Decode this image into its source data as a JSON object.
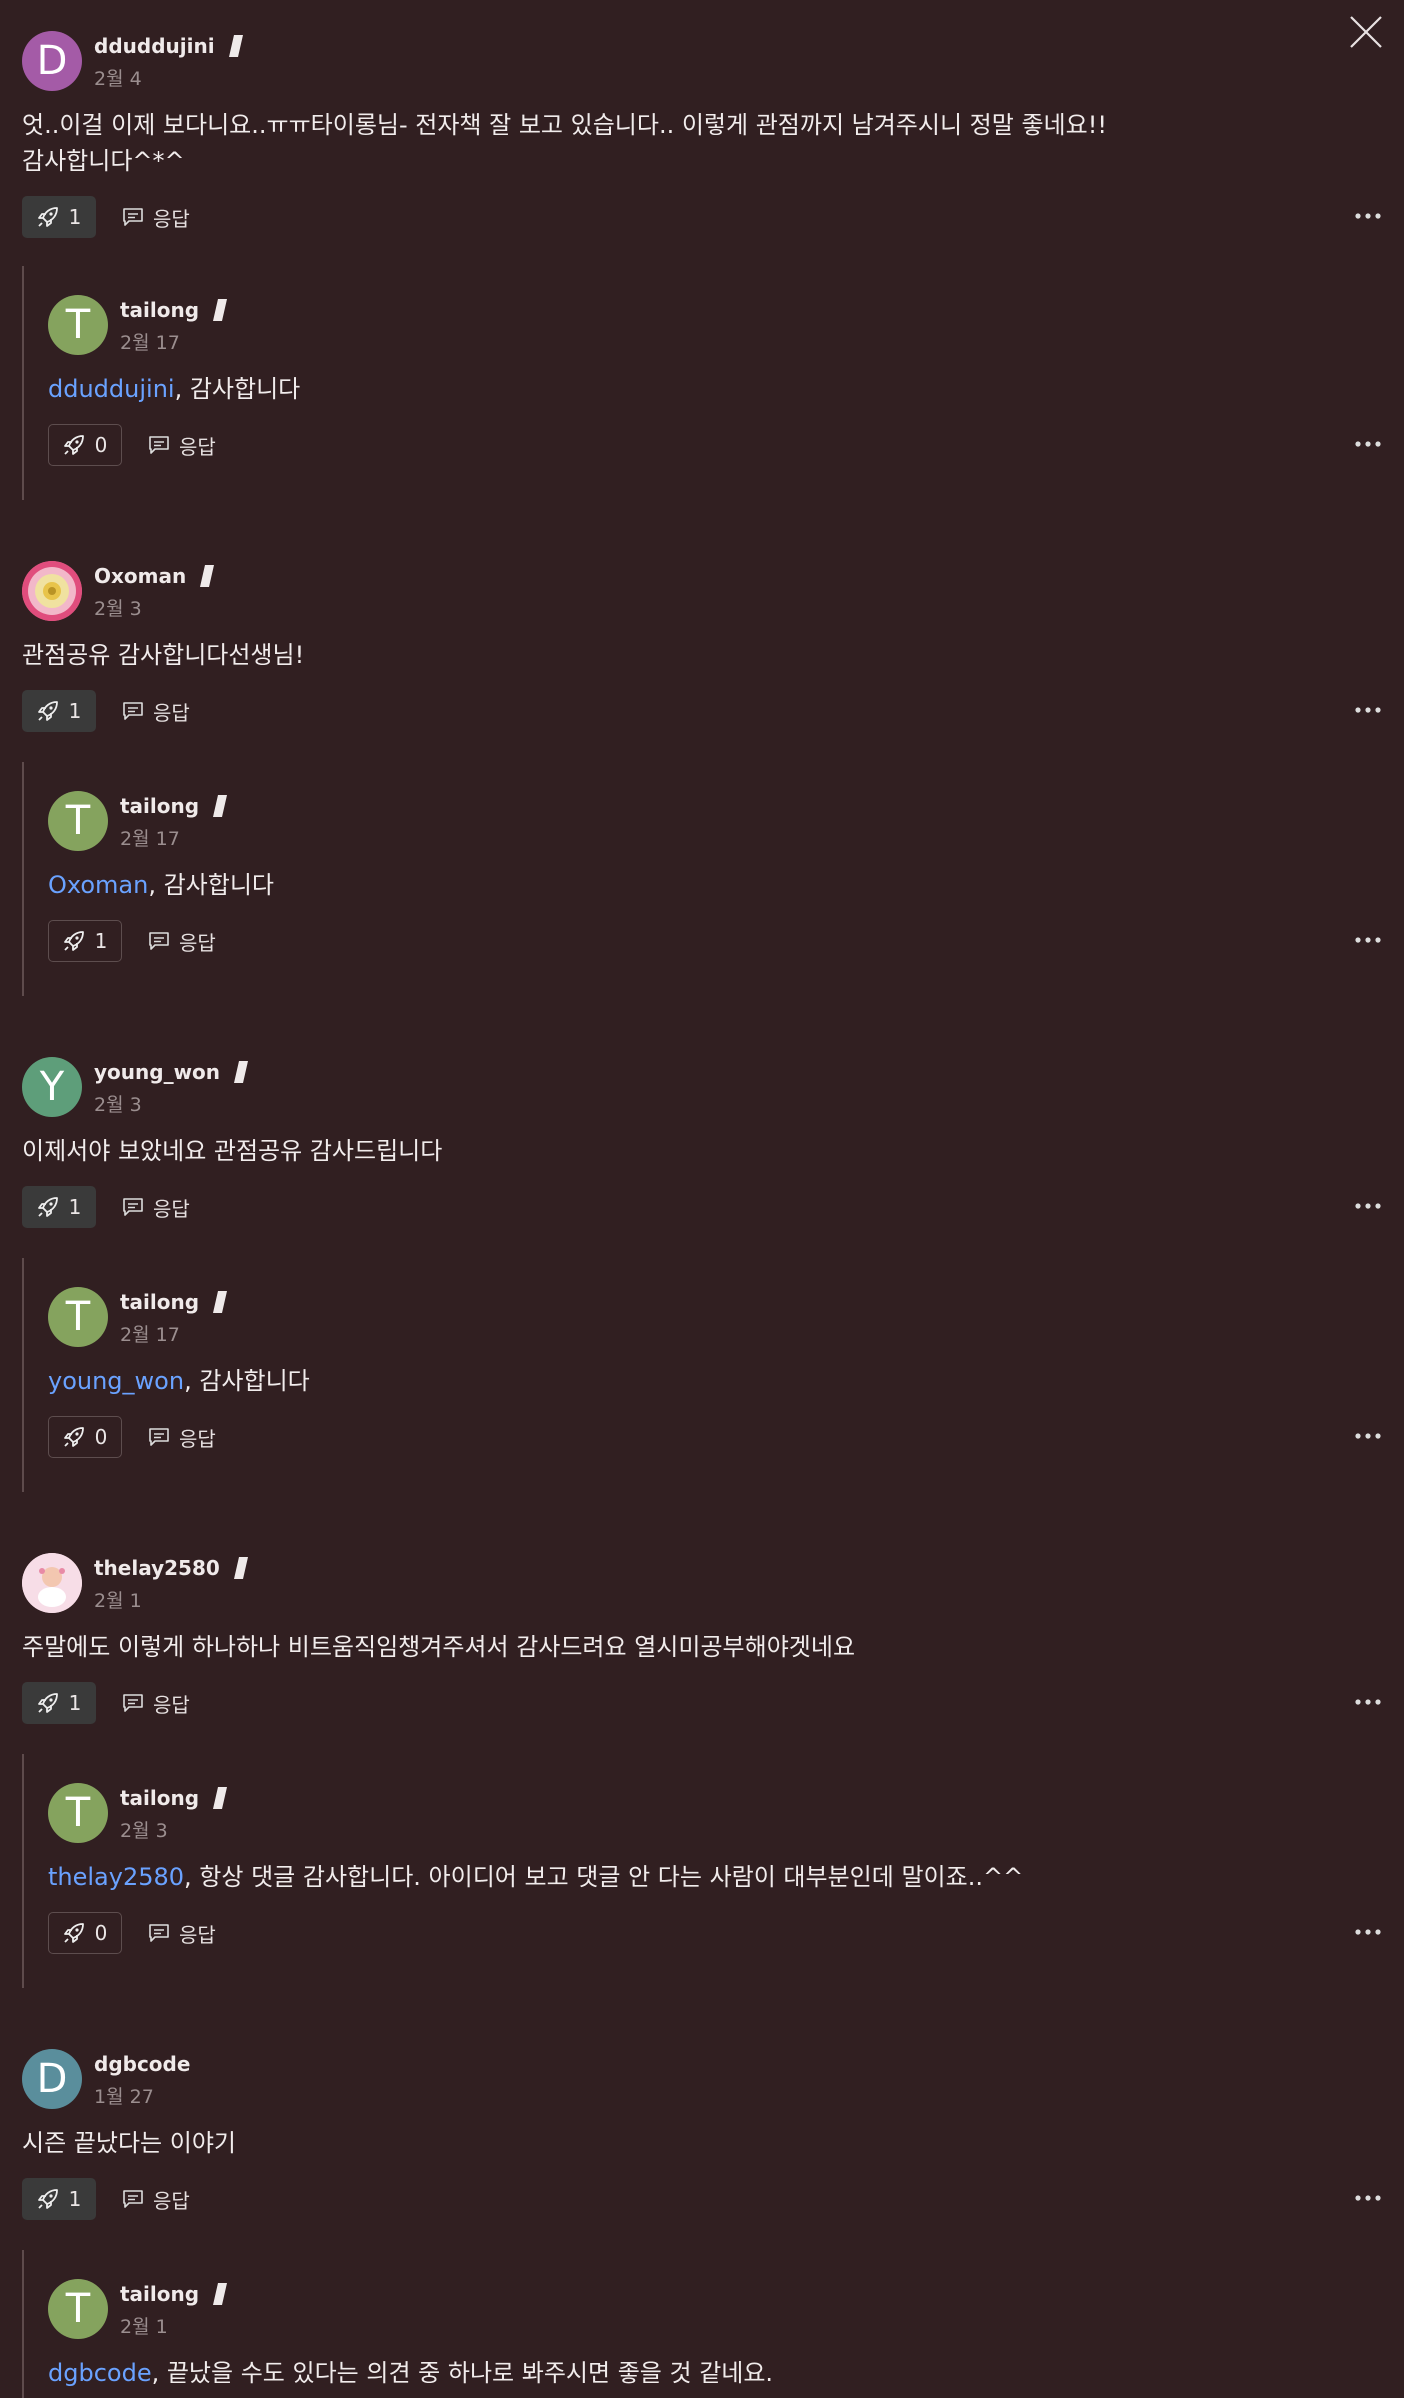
{
  "close_label": "",
  "reply_label": "응답",
  "comments": [
    {
      "user": "dduddujini",
      "date": "2월 4",
      "avatar_letter": "D",
      "avatar_color": "#a45ba7",
      "text": "엇..이걸 이제 보다니요..ㅠㅠ타이롱님- 전자책 잘 보고 있습니다.. 이렇게 관점까지 남겨주시니 정말 좋네요!!\n감사합니다^*^",
      "likes": "1",
      "reply": {
        "user": "tailong",
        "date": "2월 17",
        "avatar_letter": "T",
        "mention": "dduddujini",
        "text": ", 감사합니다",
        "likes": "0"
      }
    },
    {
      "user": "Oxoman",
      "date": "2월 3",
      "avatar_letter": "",
      "avatar_color": "#e36a8d",
      "text": "관점공유 감사합니다선생님!",
      "likes": "1",
      "reply": {
        "user": "tailong",
        "date": "2월 17",
        "avatar_letter": "T",
        "mention": "Oxoman",
        "text": ", 감사합니다",
        "likes": "1"
      }
    },
    {
      "user": "young_won",
      "date": "2월 3",
      "avatar_letter": "Y",
      "avatar_color": "#5e9e7a",
      "text": "이제서야 보았네요 관점공유 감사드립니다",
      "likes": "1",
      "reply": {
        "user": "tailong",
        "date": "2월 17",
        "avatar_letter": "T",
        "mention": "young_won",
        "text": ", 감사합니다",
        "likes": "0"
      }
    },
    {
      "user": "thelay2580",
      "date": "2월 1",
      "avatar_letter": "",
      "avatar_color": "#f4d6e2",
      "text": "주말에도 이렇게 하나하나 비트움직임챙겨주셔서 감사드려요 열시미공부해야겟네요",
      "likes": "1",
      "reply": {
        "user": "tailong",
        "date": "2월 3",
        "avatar_letter": "T",
        "mention": "thelay2580",
        "text": ", 항상 댓글 감사합니다. 아이디어 보고 댓글 안 다는 사람이 대부분인데 말이죠..^^",
        "likes": "0"
      }
    },
    {
      "user": "dgbcode",
      "date": "1월 27",
      "avatar_letter": "D",
      "avatar_color": "#5a8e9c",
      "text": "시즌 끝났다는 이야기",
      "likes": "1",
      "reply": {
        "user": "tailong",
        "date": "2월 1",
        "avatar_letter": "T",
        "mention": "dgbcode",
        "text": ", 끝났을 수도 있다는 의견 중 하나로 봐주시면 좋을 것 같네요.",
        "likes": ""
      }
    }
  ],
  "colors": {
    "background": "#311f21",
    "mention": "#6aa2ff",
    "reply_avatar": "#85a35e"
  },
  "icons": {
    "like": "rocket-icon",
    "reply": "comment-icon",
    "more": "more-dots-icon",
    "close": "close-icon",
    "badge": "slash-badge-icon"
  }
}
